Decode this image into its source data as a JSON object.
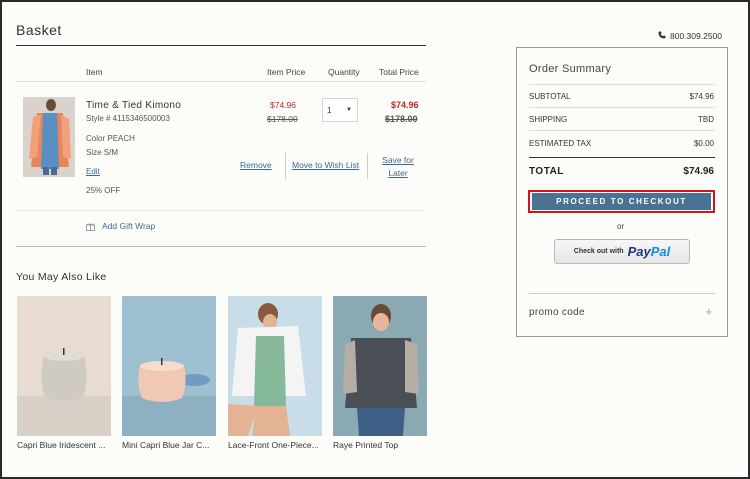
{
  "basket": {
    "title": "Basket",
    "columns": {
      "item": "Item",
      "item_price": "Item Price",
      "quantity": "Quantity",
      "total_price": "Total Price"
    },
    "item": {
      "name": "Time & Tied Kimono",
      "style": "Style # 4115346500003",
      "color_label": "Color",
      "color_value": "PEACH",
      "size_label": "Size",
      "size_value": "S/M",
      "edit": "Edit",
      "discount": "25% OFF",
      "sale_price": "$74.96",
      "original_price": "$178.00",
      "quantity": "1",
      "total_sale": "$74.96",
      "total_original": "$178.00",
      "remove": "Remove",
      "move_to_wishlist": "Move to Wish List",
      "save_for_later": "Save for Later"
    },
    "gift_wrap": "Add Gift Wrap"
  },
  "recommendations": {
    "title": "You May Also Like",
    "items": [
      {
        "name": "Capri Blue Iridescent ..."
      },
      {
        "name": "Mini Capri Blue Jar C..."
      },
      {
        "name": "Lace-Front One-Piece..."
      },
      {
        "name": "Raye Printed Top"
      }
    ]
  },
  "header": {
    "phone": "800.309.2500",
    "phone_icon": "phone-icon"
  },
  "summary": {
    "title": "Order Summary",
    "subtotal_label": "SUBTOTAL",
    "subtotal_value": "$74.96",
    "shipping_label": "SHIPPING",
    "shipping_value": "TBD",
    "tax_label": "ESTIMATED TAX",
    "tax_value": "$0.00",
    "total_label": "TOTAL",
    "total_value": "$74.96",
    "checkout": "PROCEED TO CHECKOUT",
    "or": "or",
    "paypal_prefix": "Check out with",
    "paypal_pay": "Pay",
    "paypal_pal": "Pal",
    "promo": "promo code",
    "promo_toggle": "+"
  },
  "colors": {
    "accent": "#4a7393",
    "sale": "#b22a2a",
    "highlight": "#d4141c",
    "link": "#3d6a8f"
  }
}
